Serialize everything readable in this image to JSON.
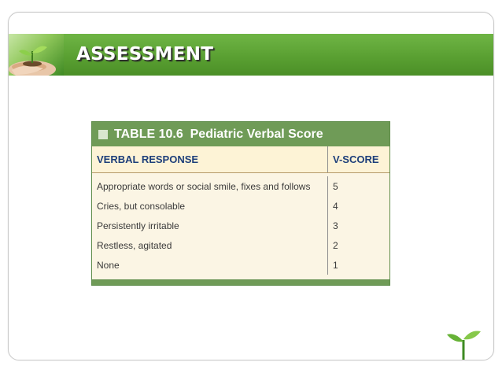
{
  "slide": {
    "title": "ASSESSMENT"
  },
  "table": {
    "caption": "TABLE 10.6  Pediatric Verbal Score",
    "headers": {
      "response": "VERBAL RESPONSE",
      "score": "V-SCORE"
    },
    "rows": [
      {
        "response": "Appropriate words or social smile, fixes and follows",
        "score": "5"
      },
      {
        "response": "Cries, but consolable",
        "score": "4"
      },
      {
        "response": "Persistently irritable",
        "score": "3"
      },
      {
        "response": "Restless, agitated",
        "score": "2"
      },
      {
        "response": "None",
        "score": "1"
      }
    ]
  },
  "colors": {
    "banner_green": "#5aa032",
    "table_header_green": "#6f9b57",
    "header_text_blue": "#1e3f7a",
    "header_row_bg": "#fdf3d6"
  },
  "icons": {
    "banner_image": "hands-holding-sprout-icon",
    "corner_decoration": "sprout-icon"
  }
}
